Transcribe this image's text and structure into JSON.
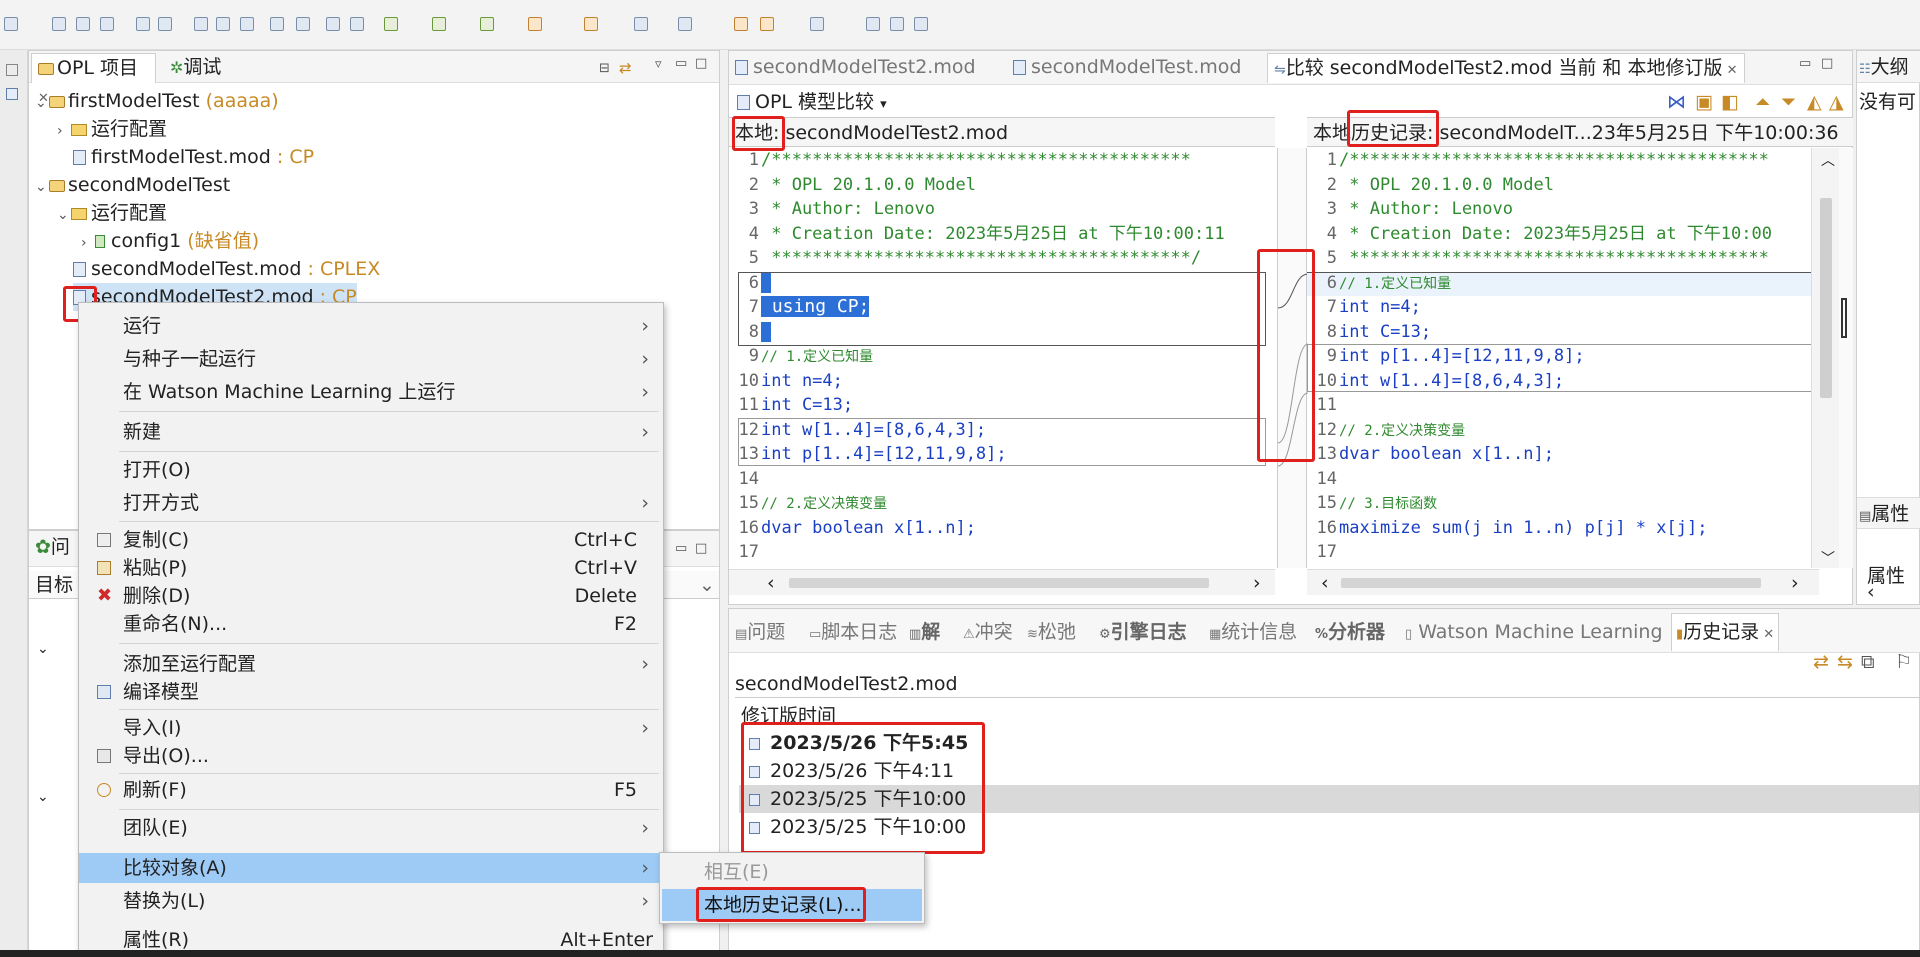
{
  "project_explorer": {
    "tab_projects": "OPL 项目",
    "tab_debug": "调试",
    "tree": [
      {
        "label": "firstModelTest",
        "suffix": "(aaaaa)"
      },
      {
        "label": "运行配置",
        "suffix": ""
      },
      {
        "label": "firstModelTest.mod",
        "suffix": ": CP"
      },
      {
        "label": "secondModelTest",
        "suffix": ""
      },
      {
        "label": "运行配置",
        "suffix": ""
      },
      {
        "label": "config1",
        "suffix": "(缺省值)"
      },
      {
        "label": "secondModelTest.mod",
        "suffix": ": CPLEX"
      },
      {
        "label": "secondModelTest2.mod",
        "suffix": ": CP"
      }
    ]
  },
  "left_lower": {
    "tab": "问",
    "header": "目标"
  },
  "editor": {
    "tabs": [
      {
        "label": "secondModelTest2.mod"
      },
      {
        "label": "secondModelTest.mod"
      },
      {
        "label": "比较 secondModelTest2.mod 当前 和 本地修订版"
      }
    ],
    "compare_title": "OPL 模型比较",
    "left_head_prefix": "本地:",
    "left_head_file": "secondModelTest2.mod",
    "right_head_prefix": "本地历史记录:",
    "right_head_file": "secondModelT...23年5月25日 下午10:00:36",
    "left_lines": [
      {
        "n": "1",
        "t": "/*****************************************"
      },
      {
        "n": "2",
        "t": " * OPL 20.1.0.0 Model"
      },
      {
        "n": "3",
        "t": " * Author: Lenovo"
      },
      {
        "n": "4",
        "t": " * Creation Date: 2023年5月25日 at 下午10:00:11"
      },
      {
        "n": "5",
        "t": " *****************************************/"
      },
      {
        "n": "6",
        "t": ""
      },
      {
        "n": "7",
        "t": "using CP;"
      },
      {
        "n": "8",
        "t": ""
      },
      {
        "n": "9",
        "t": "// 1.定义已知量"
      },
      {
        "n": "10",
        "t": "int n=4;"
      },
      {
        "n": "11",
        "t": "int C=13;"
      },
      {
        "n": "12",
        "t": "int w[1..4]=[8,6,4,3];"
      },
      {
        "n": "13",
        "t": "int p[1..4]=[12,11,9,8];"
      },
      {
        "n": "14",
        "t": ""
      },
      {
        "n": "15",
        "t": "// 2.定义决策变量"
      },
      {
        "n": "16",
        "t": "dvar boolean x[1..n];"
      },
      {
        "n": "17",
        "t": ""
      }
    ],
    "right_lines": [
      {
        "n": "1",
        "t": "/*****************************************"
      },
      {
        "n": "2",
        "t": " * OPL 20.1.0.0 Model"
      },
      {
        "n": "3",
        "t": " * Author: Lenovo"
      },
      {
        "n": "4",
        "t": " * Creation Date: 2023年5月25日 at 下午10:00"
      },
      {
        "n": "5",
        "t": " *****************************************"
      },
      {
        "n": "6",
        "t": "// 1.定义已知量"
      },
      {
        "n": "7",
        "t": "int n=4;"
      },
      {
        "n": "8",
        "t": "int C=13;"
      },
      {
        "n": "9",
        "t": "int p[1..4]=[12,11,9,8];"
      },
      {
        "n": "10",
        "t": "int w[1..4]=[8,6,4,3];"
      },
      {
        "n": "11",
        "t": ""
      },
      {
        "n": "12",
        "t": "// 2.定义决策变量"
      },
      {
        "n": "13",
        "t": "dvar boolean x[1..n];"
      },
      {
        "n": "14",
        "t": ""
      },
      {
        "n": "15",
        "t": "// 3.目标函数"
      },
      {
        "n": "16",
        "t": "maximize sum(j in 1..n) p[j] * x[j];"
      },
      {
        "n": "17",
        "t": ""
      }
    ]
  },
  "outline": {
    "tab": "大纲",
    "text": "没有可",
    "props_tab": "属性",
    "props_label": "属性"
  },
  "bottom": {
    "tabs": [
      "问题",
      "脚本日志",
      "解",
      "冲突",
      "松弛",
      "引擎日志",
      "统计信息",
      "分析器",
      "Watson Machine Learning",
      "历史记录"
    ],
    "file": "secondModelTest2.mod",
    "column": "修订版时间",
    "rows": [
      "2023/5/26 下午5:45",
      "2023/5/26 下午4:11",
      "2023/5/25 下午10:00",
      "2023/5/25 下午10:00"
    ]
  },
  "context_menu": {
    "items": [
      {
        "label": "运行",
        "shortcut": "",
        "arrow": true
      },
      {
        "label": "与种子一起运行",
        "shortcut": "",
        "arrow": true
      },
      {
        "label": "在 Watson Machine Learning 上运行",
        "shortcut": "",
        "arrow": true
      },
      {
        "label": "新建",
        "shortcut": "",
        "arrow": true
      },
      {
        "label": "打开(O)",
        "shortcut": "",
        "arrow": false
      },
      {
        "label": "打开方式",
        "shortcut": "",
        "arrow": true
      },
      {
        "label": "复制(C)",
        "shortcut": "Ctrl+C",
        "arrow": false
      },
      {
        "label": "粘贴(P)",
        "shortcut": "Ctrl+V",
        "arrow": false
      },
      {
        "label": "删除(D)",
        "shortcut": "Delete",
        "arrow": false
      },
      {
        "label": "重命名(N)...",
        "shortcut": "F2",
        "arrow": false
      },
      {
        "label": "添加至运行配置",
        "shortcut": "",
        "arrow": true
      },
      {
        "label": "编译模型",
        "shortcut": "",
        "arrow": false
      },
      {
        "label": "导入(I)",
        "shortcut": "",
        "arrow": true
      },
      {
        "label": "导出(O)...",
        "shortcut": "",
        "arrow": false
      },
      {
        "label": "刷新(F)",
        "shortcut": "F5",
        "arrow": false
      },
      {
        "label": "团队(E)",
        "shortcut": "",
        "arrow": true
      },
      {
        "label": "比较对象(A)",
        "shortcut": "",
        "arrow": true
      },
      {
        "label": "替换为(L)",
        "shortcut": "",
        "arrow": true
      },
      {
        "label": "属性(R)",
        "shortcut": "Alt+Enter",
        "arrow": false
      }
    ]
  },
  "submenu": {
    "items": [
      "相互(E)",
      "本地历史记录(L)..."
    ]
  },
  "colors": {
    "highlight": "#9ecbf5",
    "annotation": "#e0201c",
    "keyword": "#1a3fc4",
    "comment": "#2f8a2f",
    "selection": "#2c6fd6"
  }
}
